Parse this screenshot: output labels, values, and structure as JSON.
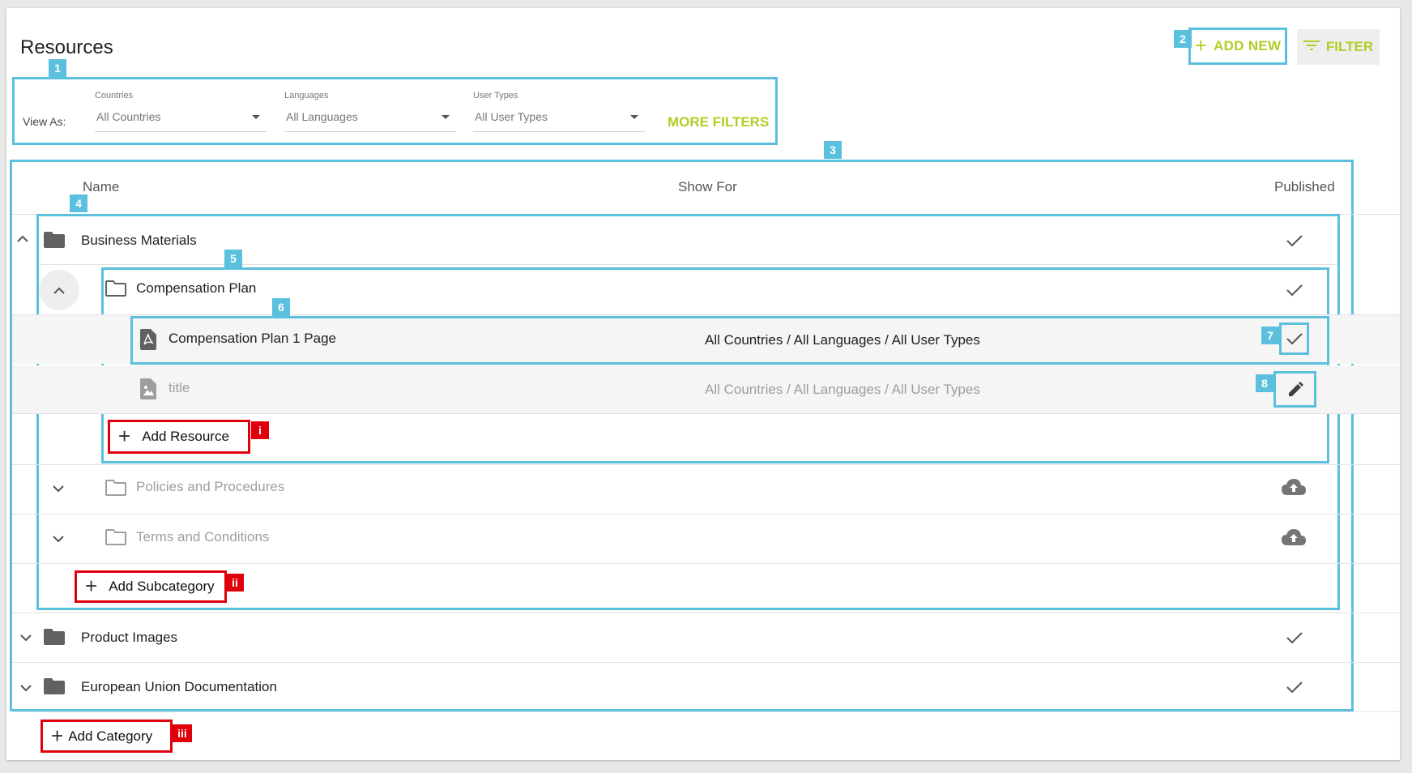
{
  "page": {
    "title": "Resources"
  },
  "toolbar": {
    "add_new_label": "ADD NEW",
    "filter_label": "FILTER"
  },
  "filters": {
    "view_as_label": "View As:",
    "countries": {
      "label": "Countries",
      "value": "All Countries"
    },
    "languages": {
      "label": "Languages",
      "value": "All Languages"
    },
    "user_types": {
      "label": "User Types",
      "value": "All User Types"
    },
    "more_filters_label": "MORE FILTERS"
  },
  "table": {
    "headers": {
      "name": "Name",
      "show_for": "Show For",
      "published": "Published"
    },
    "categories": [
      {
        "name": "Business Materials",
        "subcategories": [
          {
            "name": "Compensation Plan",
            "resources": [
              {
                "name": "Compensation Plan 1 Page",
                "show_for": "All Countries / All Languages / All User Types",
                "status": "published"
              },
              {
                "name": "title",
                "show_for": "All Countries / All Languages / All User Types",
                "status": "draft"
              }
            ],
            "add_resource_label": "Add Resource"
          },
          {
            "name": "Policies and Procedures",
            "status": "upload"
          },
          {
            "name": "Terms and Conditions",
            "status": "upload"
          }
        ],
        "add_subcategory_label": "Add Subcategory"
      },
      {
        "name": "Product Images"
      },
      {
        "name": "European Union Documentation"
      }
    ],
    "add_category_label": "Add Category"
  },
  "annotations": {
    "blue": [
      "1",
      "2",
      "3",
      "4",
      "5",
      "6",
      "7",
      "8"
    ],
    "red": [
      "i",
      "ii",
      "iii"
    ]
  },
  "colors": {
    "accent": "#b5cc26",
    "highlight": "#5bc0de",
    "annotation_red": "#e0000b"
  }
}
